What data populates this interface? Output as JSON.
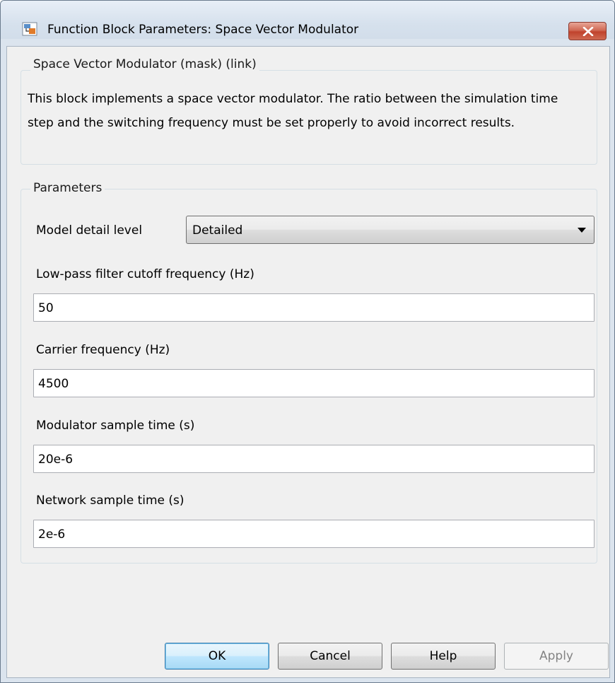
{
  "window": {
    "title": "Function Block Parameters: Space Vector Modulator",
    "close_icon": "close-icon"
  },
  "description_group": {
    "legend": "Space Vector Modulator (mask) (link)",
    "text": "This block implements a space vector modulator. The ratio between the simulation time step and the switching frequency must be set properly to avoid incorrect results."
  },
  "parameters": {
    "legend": "Parameters",
    "model_detail_level": {
      "label": "Model detail level",
      "selected": "Detailed"
    },
    "lowpass_cutoff": {
      "label": "Low-pass filter cutoff frequency (Hz)",
      "value": "50"
    },
    "carrier_frequency": {
      "label": "Carrier frequency (Hz)",
      "value": "4500"
    },
    "modulator_sample_time": {
      "label": "Modulator sample time (s)",
      "value": "20e-6"
    },
    "network_sample_time": {
      "label": "Network sample time (s)",
      "value": "2e-6"
    }
  },
  "buttons": {
    "ok": "OK",
    "cancel": "Cancel",
    "help": "Help",
    "apply": "Apply"
  }
}
